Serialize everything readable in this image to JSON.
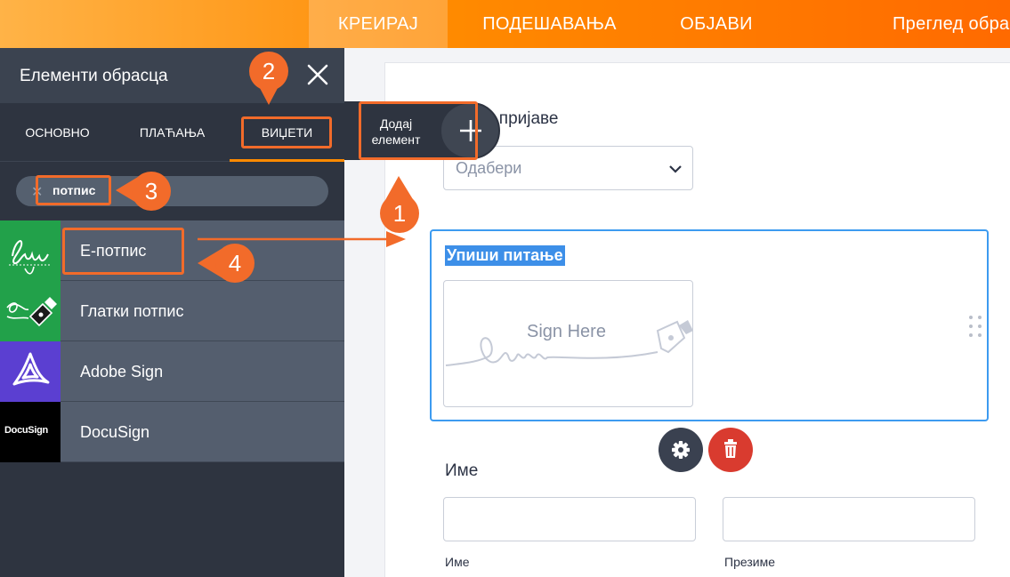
{
  "topbar": {
    "create": "КРЕИРАЈ",
    "settings": "ПОДЕШАВАЊА",
    "publish": "ОБЈАВИ",
    "preview": "Преглед обрасца"
  },
  "panel": {
    "title": "Елементи обрасца",
    "tabs": {
      "basic": "ОСНОВНО",
      "payments": "ПЛАЋАЊА",
      "widgets": "ВИЏЕТИ"
    },
    "search_value": "потпис",
    "items": [
      {
        "label": "Е-потпис",
        "icon": "sign-script-icon",
        "color": "#22a14a"
      },
      {
        "label": "Глатки потпис",
        "icon": "fountain-pen-icon",
        "color": "#22a14a"
      },
      {
        "label": "Adobe Sign",
        "icon": "adobe-icon",
        "color": "#5b3fd1"
      },
      {
        "label": "DocuSign",
        "icon": "docusign-logo",
        "color": "#000000",
        "logo_text": "DocuSign"
      }
    ]
  },
  "add_element": {
    "label": "Додај елемент"
  },
  "form": {
    "q1_label": "с пријаве",
    "q1_select": "Одабери",
    "sig_question": "Упиши питање",
    "sig_placeholder": "Sign Here",
    "name_label": "Име",
    "first_sublabel": "Име",
    "last_sublabel": "Презиме"
  },
  "annotations": {
    "b1": "1",
    "b2": "2",
    "b3": "3",
    "b4": "4"
  },
  "colors": {
    "accent": "#ff8a00",
    "annotation": "#f26b2a",
    "selected": "#3d9bf0",
    "delete": "#d93b2f"
  }
}
